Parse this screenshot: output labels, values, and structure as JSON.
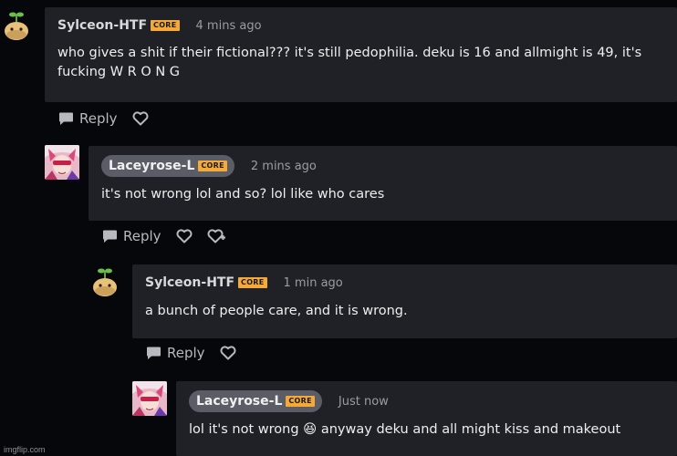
{
  "comments": [
    {
      "username": "Sylceon-HTF",
      "badge": "CORE",
      "time": "4 mins ago",
      "text": "who gives a shit if their fictional??? it's still pedophilia. deku is 16 and allmight is 49, it's fucking W R O N G",
      "reply_label": "Reply",
      "avatar": "sprout-creature-avatar"
    },
    {
      "username": "Laceyrose-L",
      "badge": "CORE",
      "time": "2 mins ago",
      "text": "it's not wrong lol and so? lol like who cares",
      "reply_label": "Reply",
      "avatar": "anime-girl-avatar"
    },
    {
      "username": "Sylceon-HTF",
      "badge": "CORE",
      "time": "1 min ago",
      "text": "a bunch of people care, and it is wrong.",
      "reply_label": "Reply",
      "avatar": "sprout-creature-avatar"
    },
    {
      "username": "Laceyrose-L",
      "badge": "CORE",
      "time": "Just now",
      "text": "lol it's not wrong 😆 anyway deku and all might kiss and makeout",
      "avatar": "anime-girl-avatar"
    }
  ],
  "colors": {
    "background": "#06070a",
    "card": "#202126",
    "core_badge": "#f4a93a",
    "pill": "#5b5d66"
  },
  "watermark": "imgflip.com"
}
